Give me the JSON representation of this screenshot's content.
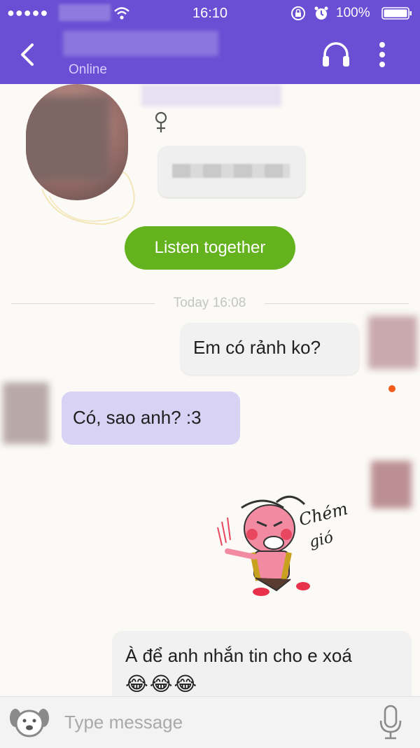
{
  "status_bar": {
    "signal": "●●●●●",
    "time": "16:10",
    "battery_text": "100%"
  },
  "header": {
    "contact_status": "Online"
  },
  "profile": {
    "gender_symbol": "♀"
  },
  "listen_button": {
    "label": "Listen together"
  },
  "divider": {
    "label": "Today 16:08"
  },
  "messages": [
    {
      "direction": "outgoing",
      "text": "Em có rảnh ko?"
    },
    {
      "direction": "incoming",
      "text": "Có, sao anh? :3"
    },
    {
      "direction": "outgoing",
      "type": "sticker",
      "sticker_text": "Chém gió"
    },
    {
      "direction": "outgoing",
      "text": "À để anh nhắn tin cho e xoá",
      "emoji": "😂😂😂"
    }
  ],
  "input": {
    "placeholder": "Type message"
  },
  "colors": {
    "header_purple": "#6a4fd4",
    "listen_green": "#64b21d",
    "incoming_bubble": "#d8d2f4",
    "outgoing_bubble": "#f1f1f1"
  },
  "icons": [
    "signal-dots-icon",
    "wifi-icon",
    "orientation-lock-icon",
    "alarm-icon",
    "battery-icon",
    "back-chevron-icon",
    "headphones-icon",
    "more-vertical-icon",
    "female-icon",
    "sticker-dog-icon",
    "microphone-icon"
  ]
}
